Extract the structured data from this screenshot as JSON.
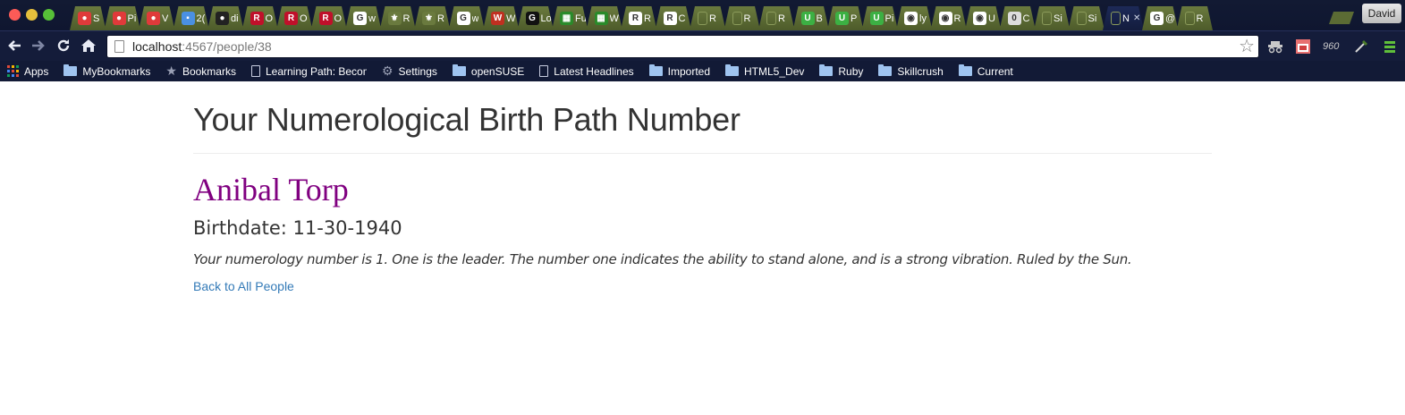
{
  "browser": {
    "tabs": [
      {
        "title": "S",
        "favicon_color": "#e03a3a",
        "favicon_glyph": "●"
      },
      {
        "title": "Pi",
        "favicon_color": "#e03a3a",
        "favicon_glyph": "●"
      },
      {
        "title": "V",
        "favicon_color": "#e03a3a",
        "favicon_glyph": "●"
      },
      {
        "title": "2(",
        "favicon_color": "#4a90e2",
        "favicon_glyph": "▪"
      },
      {
        "title": "di",
        "favicon_color": "#222222",
        "favicon_glyph": "●"
      },
      {
        "title": "O",
        "favicon_color": "#c0102a",
        "favicon_glyph": "R"
      },
      {
        "title": "O",
        "favicon_color": "#c0102a",
        "favicon_glyph": "R"
      },
      {
        "title": "O",
        "favicon_color": "#c0102a",
        "favicon_glyph": "R"
      },
      {
        "title": "w",
        "favicon_color": "#ffffff",
        "favicon_glyph": "G"
      },
      {
        "title": "R",
        "favicon_color": "#6a7a3e",
        "favicon_glyph": "⚜"
      },
      {
        "title": "R",
        "favicon_color": "#6a7a3e",
        "favicon_glyph": "⚜"
      },
      {
        "title": "w",
        "favicon_color": "#ffffff",
        "favicon_glyph": "G"
      },
      {
        "title": "W",
        "favicon_color": "#c03020",
        "favicon_glyph": "W"
      },
      {
        "title": "Lo",
        "favicon_color": "#111111",
        "favicon_glyph": "G"
      },
      {
        "title": "Fu",
        "favicon_color": "#2a8a2a",
        "favicon_glyph": "▦"
      },
      {
        "title": "W",
        "favicon_color": "#2a8a2a",
        "favicon_glyph": "▦"
      },
      {
        "title": "R",
        "favicon_color": "#ffffff",
        "favicon_glyph": "R"
      },
      {
        "title": "C",
        "favicon_color": "#ffffff",
        "favicon_glyph": "R"
      },
      {
        "title": "R",
        "favicon_color": "#6a7a3e",
        "favicon_glyph": ""
      },
      {
        "title": "R",
        "favicon_color": "#6a7a3e",
        "favicon_glyph": ""
      },
      {
        "title": "R",
        "favicon_color": "#6a7a3e",
        "favicon_glyph": ""
      },
      {
        "title": "B",
        "favicon_color": "#3cb043",
        "favicon_glyph": "U"
      },
      {
        "title": "P",
        "favicon_color": "#3cb043",
        "favicon_glyph": "U"
      },
      {
        "title": "Pi",
        "favicon_color": "#3cb043",
        "favicon_glyph": "U"
      },
      {
        "title": "ly",
        "favicon_color": "#ffffff",
        "favicon_glyph": "◉"
      },
      {
        "title": "R",
        "favicon_color": "#ffffff",
        "favicon_glyph": "◉"
      },
      {
        "title": "U",
        "favicon_color": "#ffffff",
        "favicon_glyph": "◉"
      },
      {
        "title": "C",
        "favicon_color": "#dddddd",
        "favicon_glyph": "0"
      },
      {
        "title": "Si",
        "favicon_color": "#6a7a3e",
        "favicon_glyph": ""
      },
      {
        "title": "Si",
        "favicon_color": "#6a7a3e",
        "favicon_glyph": ""
      },
      {
        "title": "N",
        "favicon_color": "#1d2a58",
        "favicon_glyph": "",
        "active": true
      },
      {
        "title": "@",
        "favicon_color": "#ffffff",
        "favicon_glyph": "G"
      },
      {
        "title": "R",
        "favicon_color": "#6a7a3e",
        "favicon_glyph": ""
      }
    ],
    "close_glyph": "✕",
    "profile_name": "David",
    "url_host": "localhost",
    "url_path": ":4567/people/38",
    "extensions": [
      "incognito-icon",
      "calendar-icon",
      "960-grid-icon",
      "eyedropper-icon",
      "stack-icon"
    ],
    "ext_960_label": "960",
    "bookmarks": [
      {
        "label": "Apps",
        "icon": "apps-icon"
      },
      {
        "label": "MyBookmarks",
        "icon": "folder-icon"
      },
      {
        "label": "Bookmarks",
        "icon": "star-icon"
      },
      {
        "label": "Learning Path: Becom",
        "icon": "doc-icon"
      },
      {
        "label": "Settings",
        "icon": "gear-icon"
      },
      {
        "label": "openSUSE",
        "icon": "folder-icon"
      },
      {
        "label": "Latest Headlines",
        "icon": "doc-icon"
      },
      {
        "label": "Imported",
        "icon": "folder-icon"
      },
      {
        "label": "HTML5_Dev",
        "icon": "folder-icon"
      },
      {
        "label": "Ruby",
        "icon": "folder-icon"
      },
      {
        "label": "Skillcrush",
        "icon": "folder-icon"
      },
      {
        "label": "Current",
        "icon": "folder-icon"
      }
    ]
  },
  "page": {
    "heading": "Your Numerological Birth Path Number",
    "person_name": "Anibal Torp",
    "birthdate": "Birthdate: 11-30-1940",
    "description": "Your numerology number is 1. One is the leader. The number one indicates the ability to stand alone, and is a strong vibration. Ruled by the Sun.",
    "back_link": "Back to All People"
  },
  "colors": {
    "name_color": "#800080",
    "link_color": "#337ab7",
    "text_color": "#333333"
  }
}
